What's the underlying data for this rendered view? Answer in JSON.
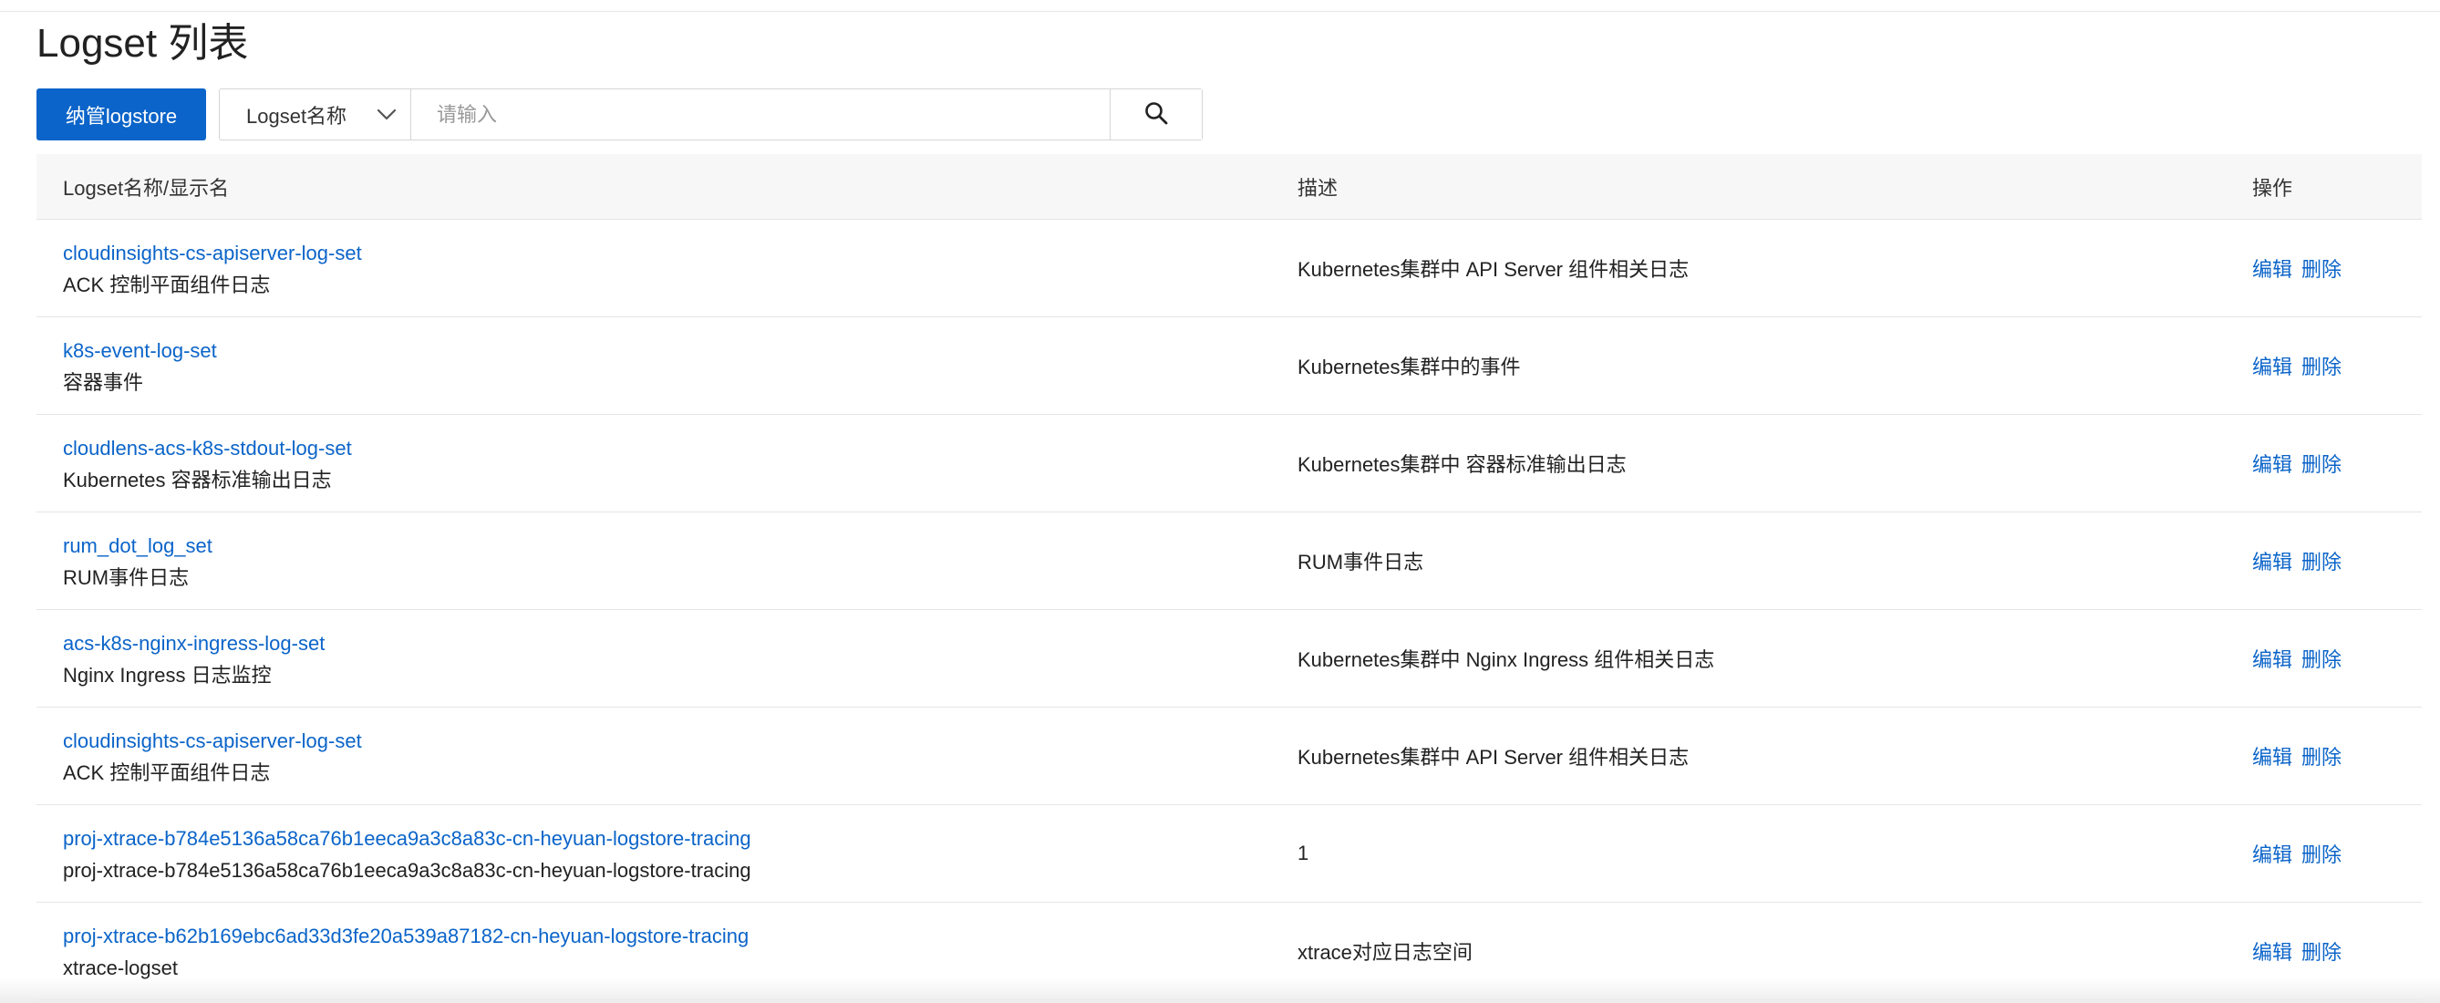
{
  "page": {
    "title": "Logset 列表"
  },
  "toolbar": {
    "primary_label": "纳管logstore",
    "search_field_selected": "Logset名称",
    "search_placeholder": "请输入",
    "search_icon": "search-icon",
    "chevron_icon": "chevron-down-icon"
  },
  "table": {
    "headers": {
      "name": "Logset名称/显示名",
      "description": "描述",
      "operations": "操作"
    },
    "op_labels": {
      "edit": "编辑",
      "delete": "删除"
    },
    "rows": [
      {
        "name": "cloudinsights-cs-apiserver-log-set",
        "display_name": "ACK 控制平面组件日志",
        "description": "Kubernetes集群中 API Server 组件相关日志"
      },
      {
        "name": "k8s-event-log-set",
        "display_name": "容器事件",
        "description": "Kubernetes集群中的事件"
      },
      {
        "name": "cloudlens-acs-k8s-stdout-log-set",
        "display_name": "Kubernetes 容器标准输出日志",
        "description": "Kubernetes集群中 容器标准输出日志"
      },
      {
        "name": "rum_dot_log_set",
        "display_name": "RUM事件日志",
        "description": "RUM事件日志"
      },
      {
        "name": "acs-k8s-nginx-ingress-log-set",
        "display_name": "Nginx Ingress 日志监控",
        "description": "Kubernetes集群中 Nginx Ingress 组件相关日志"
      },
      {
        "name": "cloudinsights-cs-apiserver-log-set",
        "display_name": "ACK 控制平面组件日志",
        "description": "Kubernetes集群中 API Server 组件相关日志"
      },
      {
        "name": "proj-xtrace-b784e5136a58ca76b1eeca9a3c8a83c-cn-heyuan-logstore-tracing",
        "display_name": "proj-xtrace-b784e5136a58ca76b1eeca9a3c8a83c-cn-heyuan-logstore-tracing",
        "description": "1"
      },
      {
        "name": "proj-xtrace-b62b169ebc6ad33d3fe20a539a87182-cn-heyuan-logstore-tracing",
        "display_name": "xtrace-logset",
        "description": "xtrace对应日志空间"
      }
    ]
  },
  "colors": {
    "primary": "#0b64c9",
    "link": "#0b64c9",
    "header_bg": "#f7f7f7",
    "border": "#e5e5e5"
  }
}
